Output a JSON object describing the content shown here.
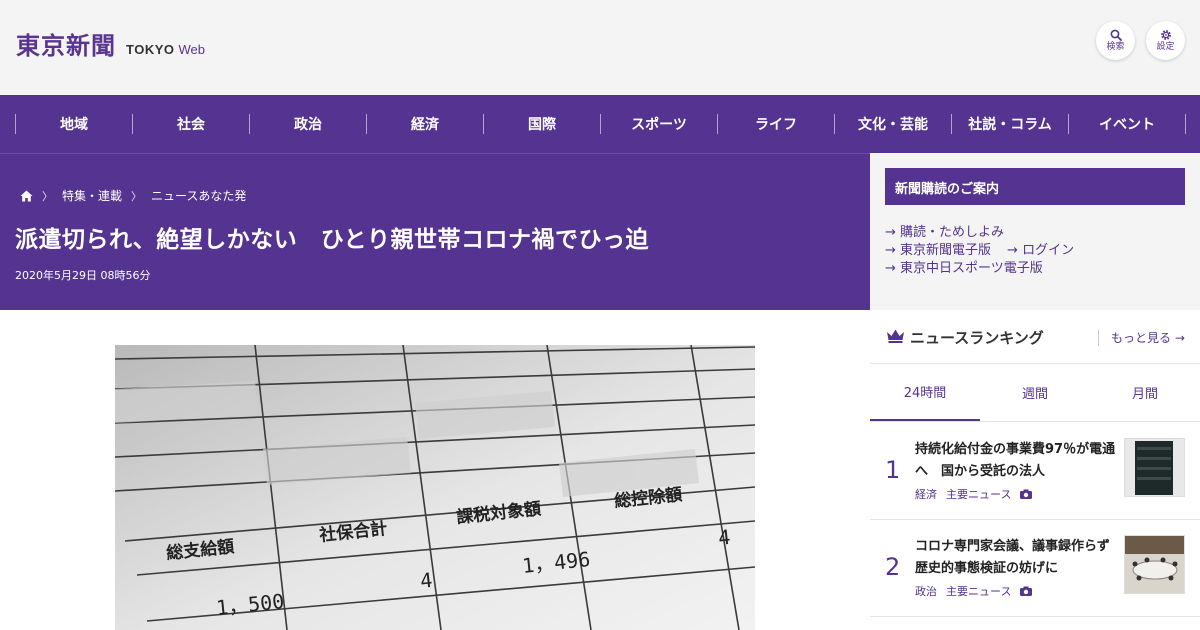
{
  "header": {
    "logo_kanji": "東京新聞",
    "logo_tokyo": "TOKYO",
    "logo_web": "Web",
    "search_label": "検索",
    "settings_label": "設定"
  },
  "nav": {
    "items": [
      "地域",
      "社会",
      "政治",
      "経済",
      "国際",
      "スポーツ",
      "ライフ",
      "文化・芸能",
      "社説・コラム",
      "イベント"
    ]
  },
  "article": {
    "breadcrumb": [
      "特集・連載",
      "ニュースあなた発"
    ],
    "title": "派遣切られ、絶望しかない　ひとり親世帯コロナ禍でひっ迫",
    "date": "2020年5月29日 08時56分",
    "photo": {
      "cell_labels": [
        "総支給額",
        "社保合計",
        "課税対象額",
        "総控除額"
      ],
      "cell_values": [
        "1，500",
        "4",
        "1，496",
        "4"
      ]
    }
  },
  "sidebar": {
    "subscribe_title": "新聞購読のご案内",
    "links": [
      "購読・ためしよみ",
      "東京新聞電子版",
      "ログイン",
      "東京中日スポーツ電子版"
    ]
  },
  "ranking": {
    "title": "ニュースランキング",
    "more": "もっと見る",
    "tabs": [
      "24時間",
      "週間",
      "月間"
    ],
    "active_tab": 0,
    "items": [
      {
        "rank": "1",
        "title": "持続化給付金の事業費97％が電通へ　国から受託の法人",
        "category": "経済",
        "tag": "主要ニュース"
      },
      {
        "rank": "2",
        "title": "コロナ専門家会議、議事録作らず　歴史的事態検証の妨げに",
        "category": "政治",
        "tag": "主要ニュース"
      }
    ]
  },
  "colors": {
    "brand": "#553390",
    "background": "#f4f4f4"
  }
}
